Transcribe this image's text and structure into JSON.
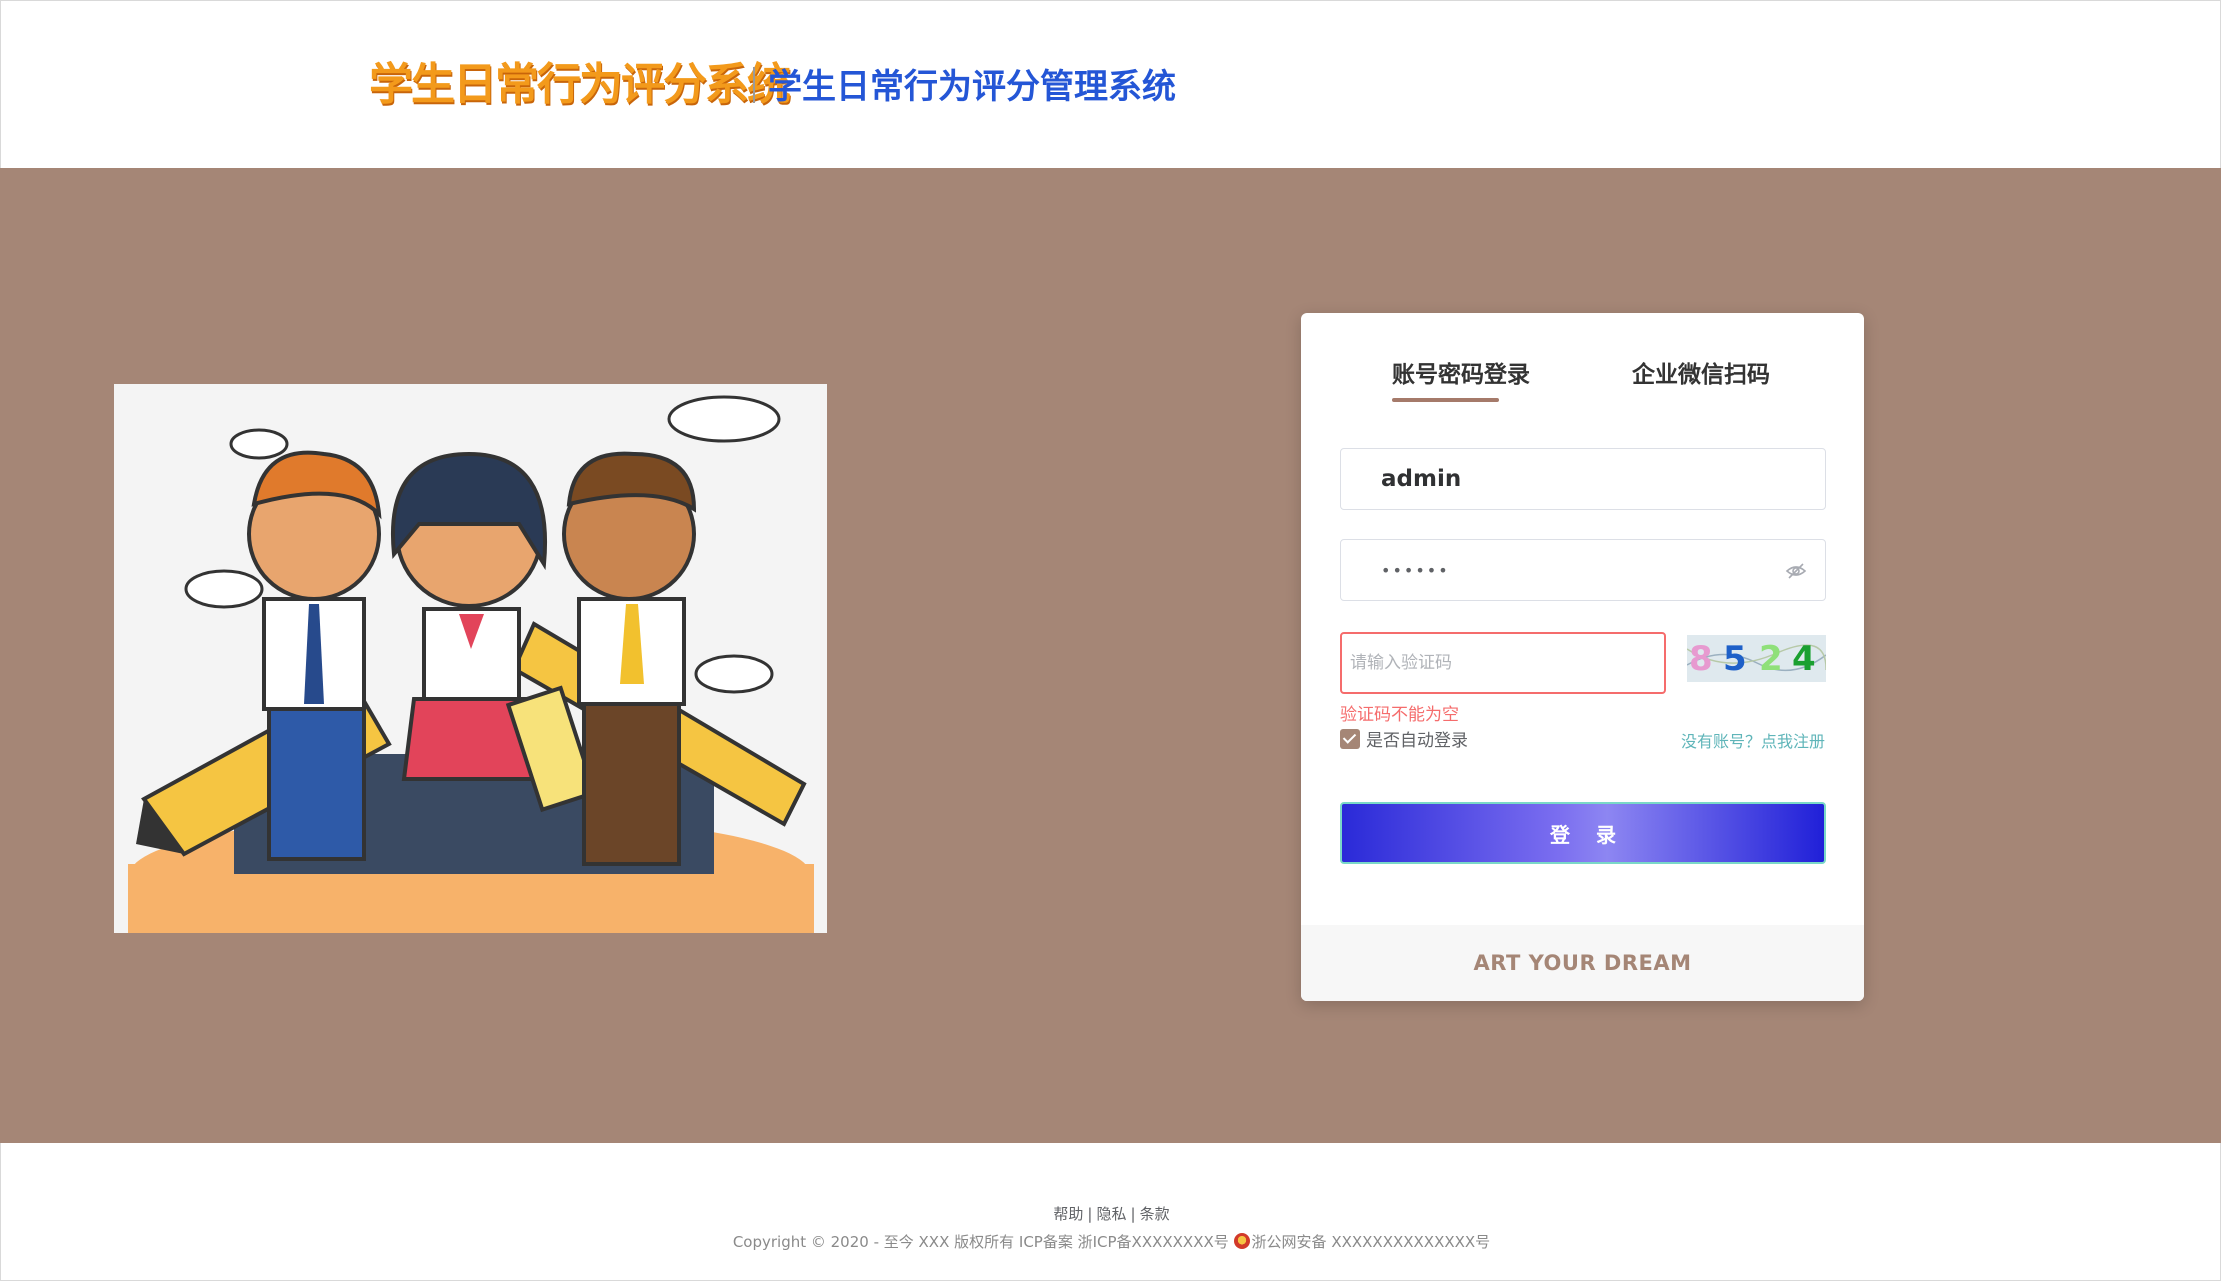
{
  "header": {
    "logo_text": "学生日常行为评分系统",
    "system_title": "学生日常行为评分管理系统"
  },
  "login": {
    "tabs": [
      {
        "label": "账号密码登录",
        "active": true
      },
      {
        "label": "企业微信扫码",
        "active": false
      }
    ],
    "username": "admin",
    "password_mask": "••••••",
    "captcha_placeholder": "请输入验证码",
    "captcha_code": [
      "8",
      "5",
      "2",
      "4"
    ],
    "captcha_colors": [
      "#e79ad0",
      "#1e60c8",
      "#8fe07a",
      "#1aa030"
    ],
    "error_message": "验证码不能为空",
    "remember_label": "是否自动登录",
    "remember_checked": true,
    "register_link": "没有账号？点我注册",
    "login_button": "登录",
    "slogan": "ART YOUR DREAM"
  },
  "footer": {
    "links": [
      "帮助",
      "隐私",
      "条款"
    ],
    "copyright": "Copyright © 2020 - 至今 XXX 版权所有 ICP备案 浙ICP备XXXXXXXX号",
    "police_record": "浙公网安备 XXXXXXXXXXXXXX号"
  },
  "colors": {
    "band": "#a58676",
    "accent": "#a57a6a",
    "logo_orange": "#f39a1b",
    "title_blue": "#2456d6",
    "error": "#f56c6c",
    "link": "#5fb5b9"
  }
}
